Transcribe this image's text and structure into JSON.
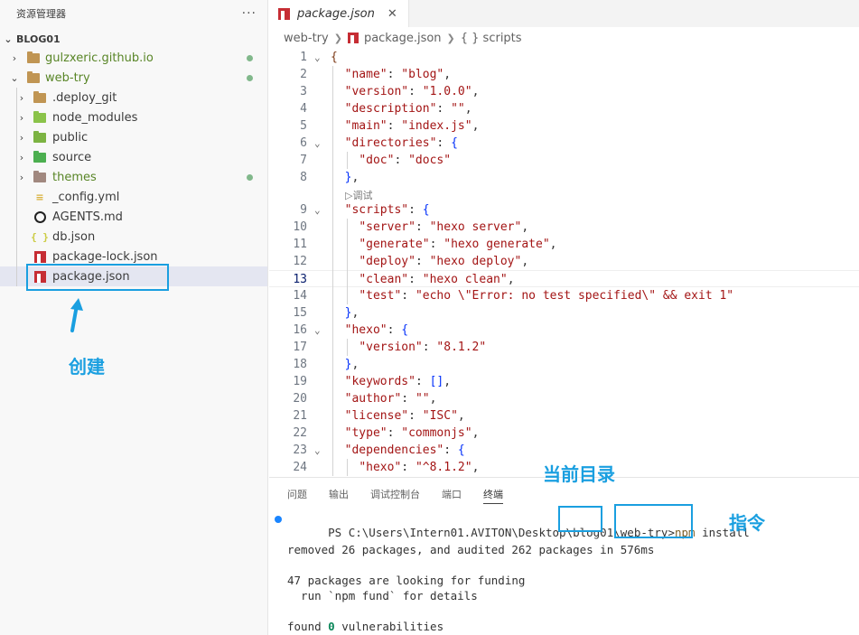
{
  "sidebar": {
    "title": "资源管理器",
    "more": "···",
    "section": "BLOG01",
    "items": [
      {
        "label": "gulzxeric.github.io",
        "kind": "folder",
        "twist": "›",
        "git": true
      },
      {
        "label": "web-try",
        "kind": "folder-open",
        "twist": "⌄",
        "git": true
      },
      {
        "label": ".deploy_git",
        "kind": "folder",
        "twist": "›",
        "git": false
      },
      {
        "label": "node_modules",
        "kind": "folder-node",
        "twist": "›",
        "git": false
      },
      {
        "label": "public",
        "kind": "folder-public",
        "twist": "›",
        "git": false
      },
      {
        "label": "source",
        "kind": "folder-src",
        "twist": "›",
        "git": false
      },
      {
        "label": "themes",
        "kind": "folder-theme",
        "twist": "›",
        "git": true
      },
      {
        "label": "_config.yml",
        "kind": "yml",
        "twist": "",
        "git": false
      },
      {
        "label": "AGENTS.md",
        "kind": "md",
        "twist": "",
        "git": false
      },
      {
        "label": "db.json",
        "kind": "json",
        "twist": "",
        "git": false
      },
      {
        "label": "package-lock.json",
        "kind": "npm",
        "twist": "",
        "git": false
      },
      {
        "label": "package.json",
        "kind": "npm",
        "twist": "",
        "git": false
      }
    ],
    "annotation": "创建"
  },
  "editor": {
    "tab_label": "package.json",
    "tab_close": "✕",
    "breadcrumb": [
      "web-try",
      "package.json",
      "{ } scripts"
    ],
    "codelens": "▷调试",
    "lines": [
      {
        "n": "1",
        "t": "{"
      },
      {
        "n": "2",
        "t": "  \"name\": \"blog\","
      },
      {
        "n": "3",
        "t": "  \"version\": \"1.0.0\","
      },
      {
        "n": "4",
        "t": "  \"description\": \"\","
      },
      {
        "n": "5",
        "t": "  \"main\": \"index.js\","
      },
      {
        "n": "6",
        "t": "  \"directories\": {"
      },
      {
        "n": "7",
        "t": "    \"doc\": \"docs\""
      },
      {
        "n": "8",
        "t": "  },"
      },
      {
        "n": "9",
        "t": "  \"scripts\": {"
      },
      {
        "n": "10",
        "t": "    \"server\": \"hexo server\","
      },
      {
        "n": "11",
        "t": "    \"generate\": \"hexo generate\","
      },
      {
        "n": "12",
        "t": "    \"deploy\": \"hexo deploy\","
      },
      {
        "n": "13",
        "t": "    \"clean\": \"hexo clean\","
      },
      {
        "n": "14",
        "t": "    \"test\": \"echo \\\"Error: no test specified\\\" && exit 1\""
      },
      {
        "n": "15",
        "t": "  },"
      },
      {
        "n": "16",
        "t": "  \"hexo\": {"
      },
      {
        "n": "17",
        "t": "    \"version\": \"8.1.2\""
      },
      {
        "n": "18",
        "t": "  },"
      },
      {
        "n": "19",
        "t": "  \"keywords\": [],"
      },
      {
        "n": "20",
        "t": "  \"author\": \"\","
      },
      {
        "n": "21",
        "t": "  \"license\": \"ISC\","
      },
      {
        "n": "22",
        "t": "  \"type\": \"commonjs\","
      },
      {
        "n": "23",
        "t": "  \"dependencies\": {"
      },
      {
        "n": "24",
        "t": "    \"hexo\": \"^8.1.2\","
      }
    ],
    "folds": [
      "1",
      "6",
      "9",
      "16",
      "23"
    ],
    "current_line": "13"
  },
  "panel": {
    "tabs": [
      "问题",
      "输出",
      "调试控制台",
      "端口",
      "终端"
    ],
    "active_tab": "终端",
    "prompt_prefix": "PS C:\\Users\\Intern01.AVITON\\Desktop\\blog01\\",
    "prompt_dir": "web-try",
    "prompt_gt": ">",
    "cmd_npm": "npm",
    "cmd_rest": " install",
    "output": [
      "removed 26 packages, and audited 262 packages in 576ms",
      "",
      "47 packages are looking for funding",
      "  run `npm fund` for details",
      ""
    ],
    "vuln_prefix": "found ",
    "vuln_count": "0",
    "vuln_suffix": " vulnerabilities"
  },
  "annotations": {
    "current_dir": "当前目录",
    "command": "指令"
  },
  "colors": {
    "highlight": "#1a9fe0",
    "git_modified": "#81b88b",
    "npm_red": "#c62d34"
  }
}
